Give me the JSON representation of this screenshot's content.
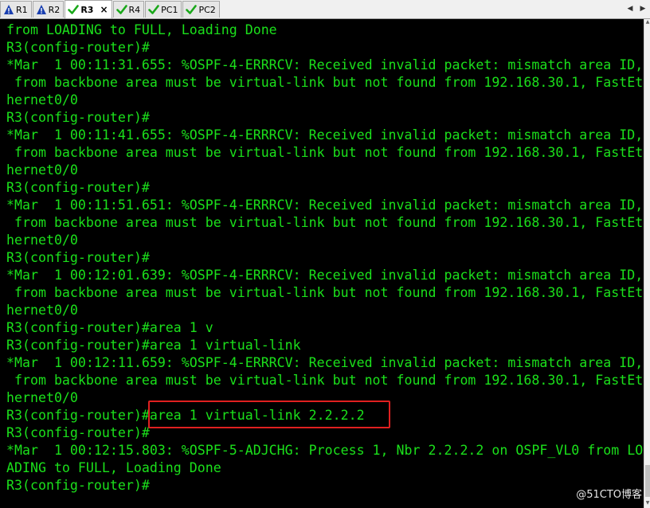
{
  "tabs": [
    {
      "label": "R1",
      "status": "warning",
      "active": false
    },
    {
      "label": "R2",
      "status": "warning",
      "active": false
    },
    {
      "label": "R3",
      "status": "ok",
      "active": true
    },
    {
      "label": "R4",
      "status": "ok",
      "active": false
    },
    {
      "label": "PC1",
      "status": "ok",
      "active": false
    },
    {
      "label": "PC2",
      "status": "ok",
      "active": false
    }
  ],
  "tab_close_glyph": "×",
  "nav": {
    "prev": "◀",
    "next": "▶"
  },
  "terminal": {
    "lines": [
      "from LOADING to FULL, Loading Done",
      "R3(config-router)#",
      "*Mar  1 00:11:31.655: %OSPF-4-ERRRCV: Received invalid packet: mismatch area ID,",
      " from backbone area must be virtual-link but not found from 192.168.30.1, FastEt",
      "hernet0/0",
      "R3(config-router)#",
      "*Mar  1 00:11:41.655: %OSPF-4-ERRRCV: Received invalid packet: mismatch area ID,",
      " from backbone area must be virtual-link but not found from 192.168.30.1, FastEt",
      "hernet0/0",
      "R3(config-router)#",
      "*Mar  1 00:11:51.651: %OSPF-4-ERRRCV: Received invalid packet: mismatch area ID,",
      " from backbone area must be virtual-link but not found from 192.168.30.1, FastEt",
      "hernet0/0",
      "R3(config-router)#",
      "*Mar  1 00:12:01.639: %OSPF-4-ERRRCV: Received invalid packet: mismatch area ID,",
      " from backbone area must be virtual-link but not found from 192.168.30.1, FastEt",
      "hernet0/0",
      "R3(config-router)#area 1 v",
      "R3(config-router)#area 1 virtual-link",
      "*Mar  1 00:12:11.659: %OSPF-4-ERRRCV: Received invalid packet: mismatch area ID,",
      " from backbone area must be virtual-link but not found from 192.168.30.1, FastEt",
      "hernet0/0",
      "R3(config-router)#area 1 virtual-link 2.2.2.2",
      "R3(config-router)#",
      "*Mar  1 00:12:15.803: %OSPF-5-ADJCHG: Process 1, Nbr 2.2.2.2 on OSPF_VL0 from LO",
      "ADING to FULL, Loading Done",
      "R3(config-router)#"
    ],
    "text_color": "#1be01b",
    "background": "#000000"
  },
  "watermark": "@51CTO博客",
  "colors": {
    "warning": "#1a3fb0",
    "ok": "#1aa81a",
    "highlight": "#e02020"
  }
}
